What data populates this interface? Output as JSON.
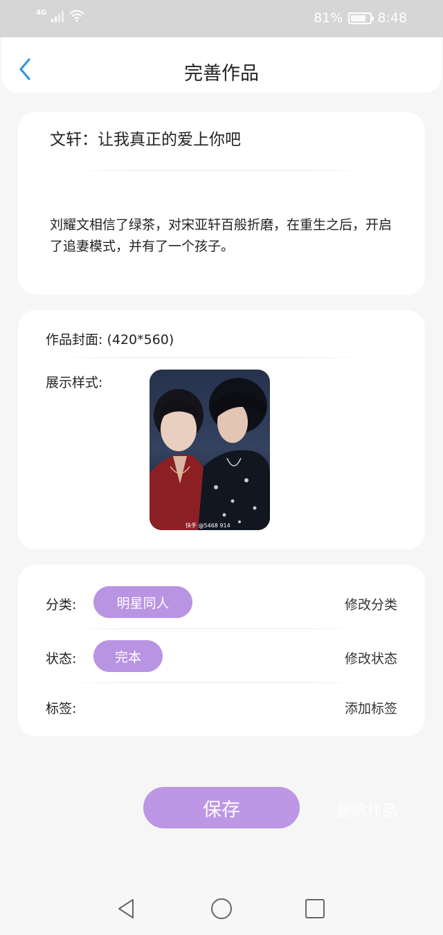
{
  "status_bar": {
    "network": "4G",
    "battery_percent": "81%",
    "battery_level": 0.81,
    "time": "8:48",
    "icons": [
      "signal-icon",
      "wifi-icon",
      "battery-icon"
    ]
  },
  "header": {
    "title": "完善作品",
    "back_icon": "chevron-left-icon",
    "accent_color": "#2e95e8"
  },
  "work": {
    "title": "文轩：让我真正的爱上你吧",
    "description": "刘耀文相信了绿茶，对宋亚轩百般折磨，在重生之后，开启了追妻模式，并有了一个孩子。"
  },
  "cover": {
    "label": "作品封面:",
    "size": "(420*560)",
    "display_label": "展示样式:",
    "image_caption": "快手 @5468  914"
  },
  "meta": {
    "category_label": "分类:",
    "category_value": "明星同人",
    "category_action": "修改分类",
    "status_label": "状态:",
    "status_value": "完本",
    "status_action": "修改状态",
    "tags_label": "标签:",
    "tags_action": "添加标签",
    "pill_color": "#b994e3"
  },
  "actions": {
    "save_label": "保存",
    "delete_label": "删除作品"
  },
  "system_nav": {
    "icons": [
      "back-triangle-icon",
      "home-circle-icon",
      "recents-square-icon"
    ]
  }
}
